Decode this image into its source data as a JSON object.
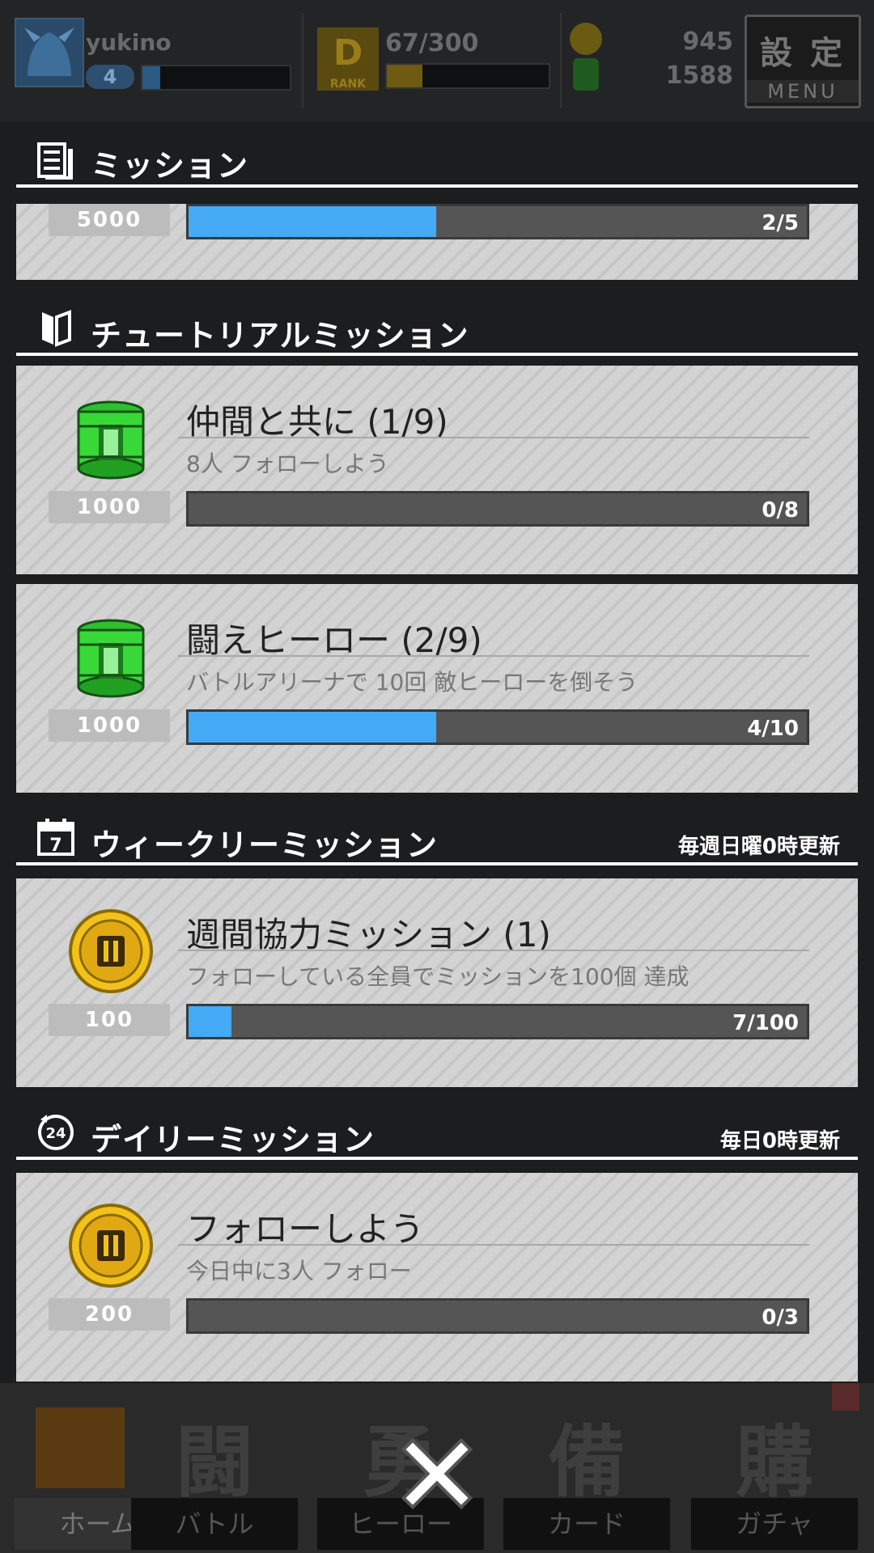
{
  "status_bar": {
    "username": "yukino",
    "level": "4",
    "rank_text": "67/300",
    "rank_badge": "RANK",
    "coins": "945",
    "gems": "1588",
    "menu_kanji": "設 定",
    "menu_label": "MENU"
  },
  "panel": {
    "header_title": "ミッション",
    "partial_card": {
      "reward": "5000",
      "progress_text": "2/5",
      "progress": 0.4
    },
    "sections": [
      {
        "title": "チュートリアルミッション",
        "update_note": "",
        "missions": [
          {
            "title": "仲間と共に (1/9)",
            "desc": "8人 フォローしよう",
            "reward": "1000",
            "reward_icon": "green-barrel-icon",
            "progress_text": "0/8",
            "progress": 0.0
          },
          {
            "title": "闘えヒーロー (2/9)",
            "desc": "バトルアリーナで 10回 敵ヒーローを倒そう",
            "reward": "1000",
            "reward_icon": "green-barrel-icon",
            "progress_text": "4/10",
            "progress": 0.4
          }
        ]
      },
      {
        "title": "ウィークリーミッション",
        "update_note": "毎週日曜0時更新",
        "missions": [
          {
            "title": "週間協力ミッション (1)",
            "desc": "フォローしている全員でミッションを100個 達成",
            "reward": "100",
            "reward_icon": "gold-coin-icon",
            "progress_text": "7/100",
            "progress": 0.07
          }
        ]
      },
      {
        "title": "デイリーミッション",
        "update_note": "毎日0時更新",
        "missions": [
          {
            "title": "フォローしよう",
            "desc": "今日中に3人 フォロー",
            "reward": "200",
            "reward_icon": "gold-coin-icon",
            "progress_text": "0/3",
            "progress": 0.0
          }
        ]
      }
    ]
  },
  "bottom_nav": [
    {
      "label": "ホーム",
      "glyph": ""
    },
    {
      "label": "バトル",
      "glyph": "闘"
    },
    {
      "label": "ヒーロー",
      "glyph": "勇"
    },
    {
      "label": "カード",
      "glyph": "備"
    },
    {
      "label": "ガチャ",
      "glyph": "購"
    }
  ],
  "colors": {
    "progress_fill": "#44aaf5",
    "accent_home": "#e07a10"
  }
}
